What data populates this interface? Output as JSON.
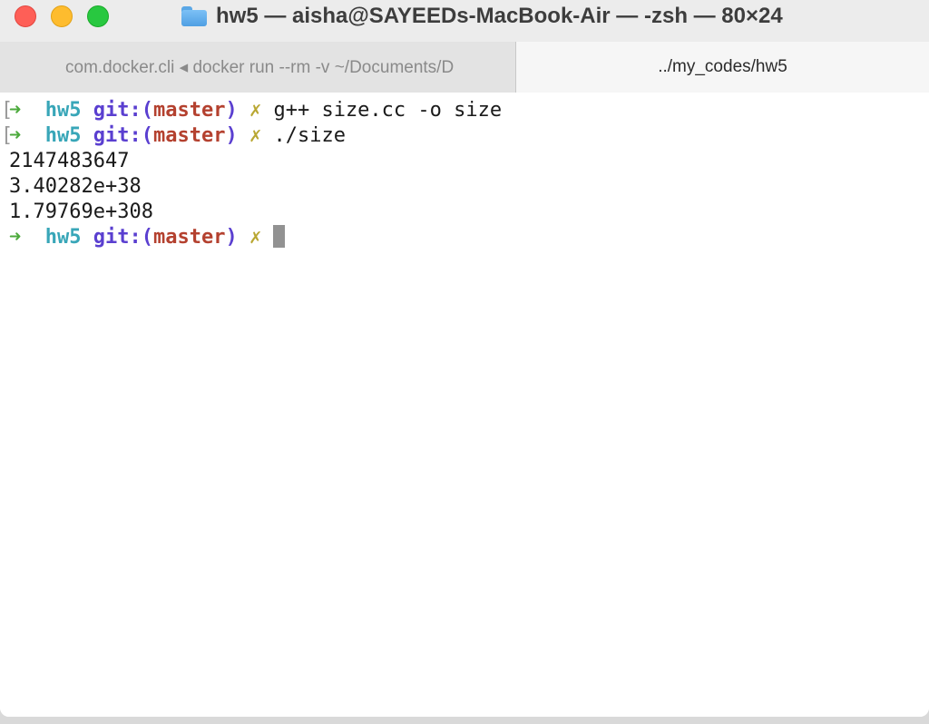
{
  "window": {
    "title": "hw5 — aisha@SAYEEDs-MacBook-Air — -zsh — 80×24",
    "folder_icon": "folder-icon"
  },
  "tabs": [
    {
      "label": "com.docker.cli ◂ docker run --rm -v ~/Documents/D",
      "active": false
    },
    {
      "label": "../my_codes/hw5",
      "active": true
    }
  ],
  "prompt": {
    "arrow": "➜",
    "dir": "hw5",
    "git_label": "git:",
    "paren_open": "(",
    "branch": "master",
    "paren_close": ")",
    "dirty": "✗",
    "bracket": "["
  },
  "terminal": {
    "commands": [
      "g++ size.cc -o size",
      "./size"
    ],
    "output": [
      "2147483647",
      "3.40282e+38",
      "1.79769e+308"
    ]
  },
  "colors": {
    "arrow": "#4caa3c",
    "dir": "#38a6b8",
    "git": "#5a3fd0",
    "branch": "#b4412f",
    "dirty": "#b9a732"
  }
}
